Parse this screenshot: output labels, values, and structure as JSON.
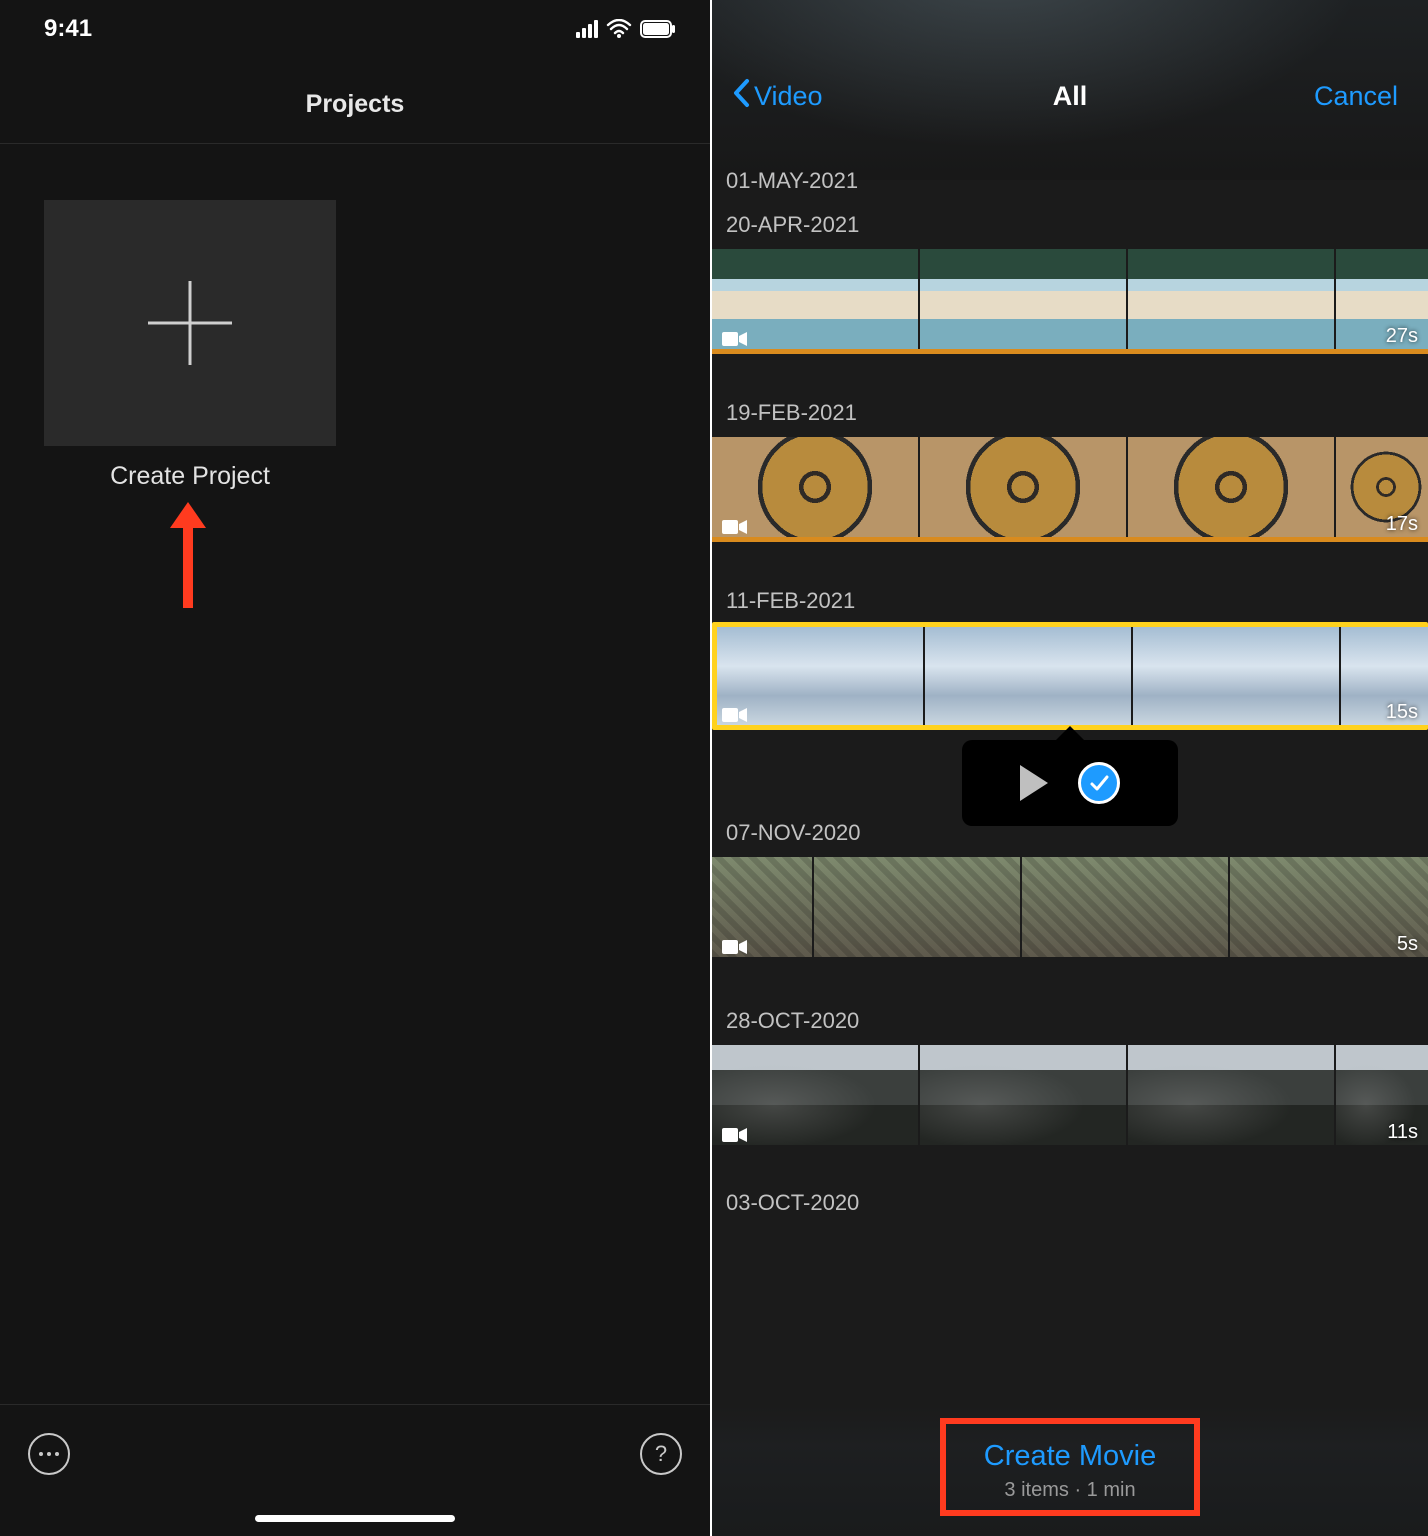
{
  "left": {
    "time": "9:41",
    "title": "Projects",
    "create_label": "Create Project"
  },
  "right": {
    "nav": {
      "back": "Video",
      "title": "All",
      "cancel": "Cancel"
    },
    "dates": {
      "d0": "01-MAY-2021",
      "d1": "20-APR-2021",
      "d2": "19-FEB-2021",
      "d3": "11-FEB-2021",
      "d4": "07-NOV-2020",
      "d5": "28-OCT-2020",
      "d6": "03-OCT-2020"
    },
    "durations": {
      "c1": "27s",
      "c2": "17s",
      "c3": "15s",
      "c4": "5s",
      "c5": "11s"
    },
    "create": {
      "label": "Create Movie",
      "meta": "3 items · 1 min"
    }
  },
  "colors": {
    "accent": "#1e9bff",
    "annotation": "#ff3b1f",
    "select": "#ffd21e"
  }
}
